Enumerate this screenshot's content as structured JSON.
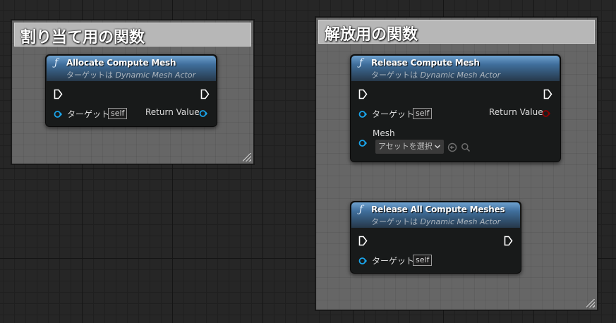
{
  "comments": {
    "allocate": {
      "title": "割り当て用の関数"
    },
    "release": {
      "title": "解放用の関数"
    }
  },
  "nodes": {
    "allocate": {
      "title": "Allocate Compute Mesh",
      "subtitle_prefix": "ターゲットは",
      "subtitle_class": "Dynamic Mesh Actor",
      "target_label": "ターゲット",
      "target_value": "self",
      "return_label": "Return Value"
    },
    "release": {
      "title": "Release Compute Mesh",
      "subtitle_prefix": "ターゲットは",
      "subtitle_class": "Dynamic Mesh Actor",
      "target_label": "ターゲット",
      "target_value": "self",
      "return_label": "Return Value",
      "mesh_label": "Mesh",
      "mesh_select": "アセットを選択",
      "mesh_select_icon": "chevron-down-icon"
    },
    "release_all": {
      "title": "Release All Compute Meshes",
      "subtitle_prefix": "ターゲットは",
      "subtitle_class": "Dynamic Mesh Actor",
      "target_label": "ターゲット",
      "target_value": "self"
    }
  },
  "colors": {
    "object_pin": "#1aa3e8",
    "bool_pin": "#8c0000",
    "exec_pin": "#ffffff",
    "comment_bg": "#666666",
    "comment_header": "#b7b7b7",
    "function_header": "#4a7aa8"
  }
}
